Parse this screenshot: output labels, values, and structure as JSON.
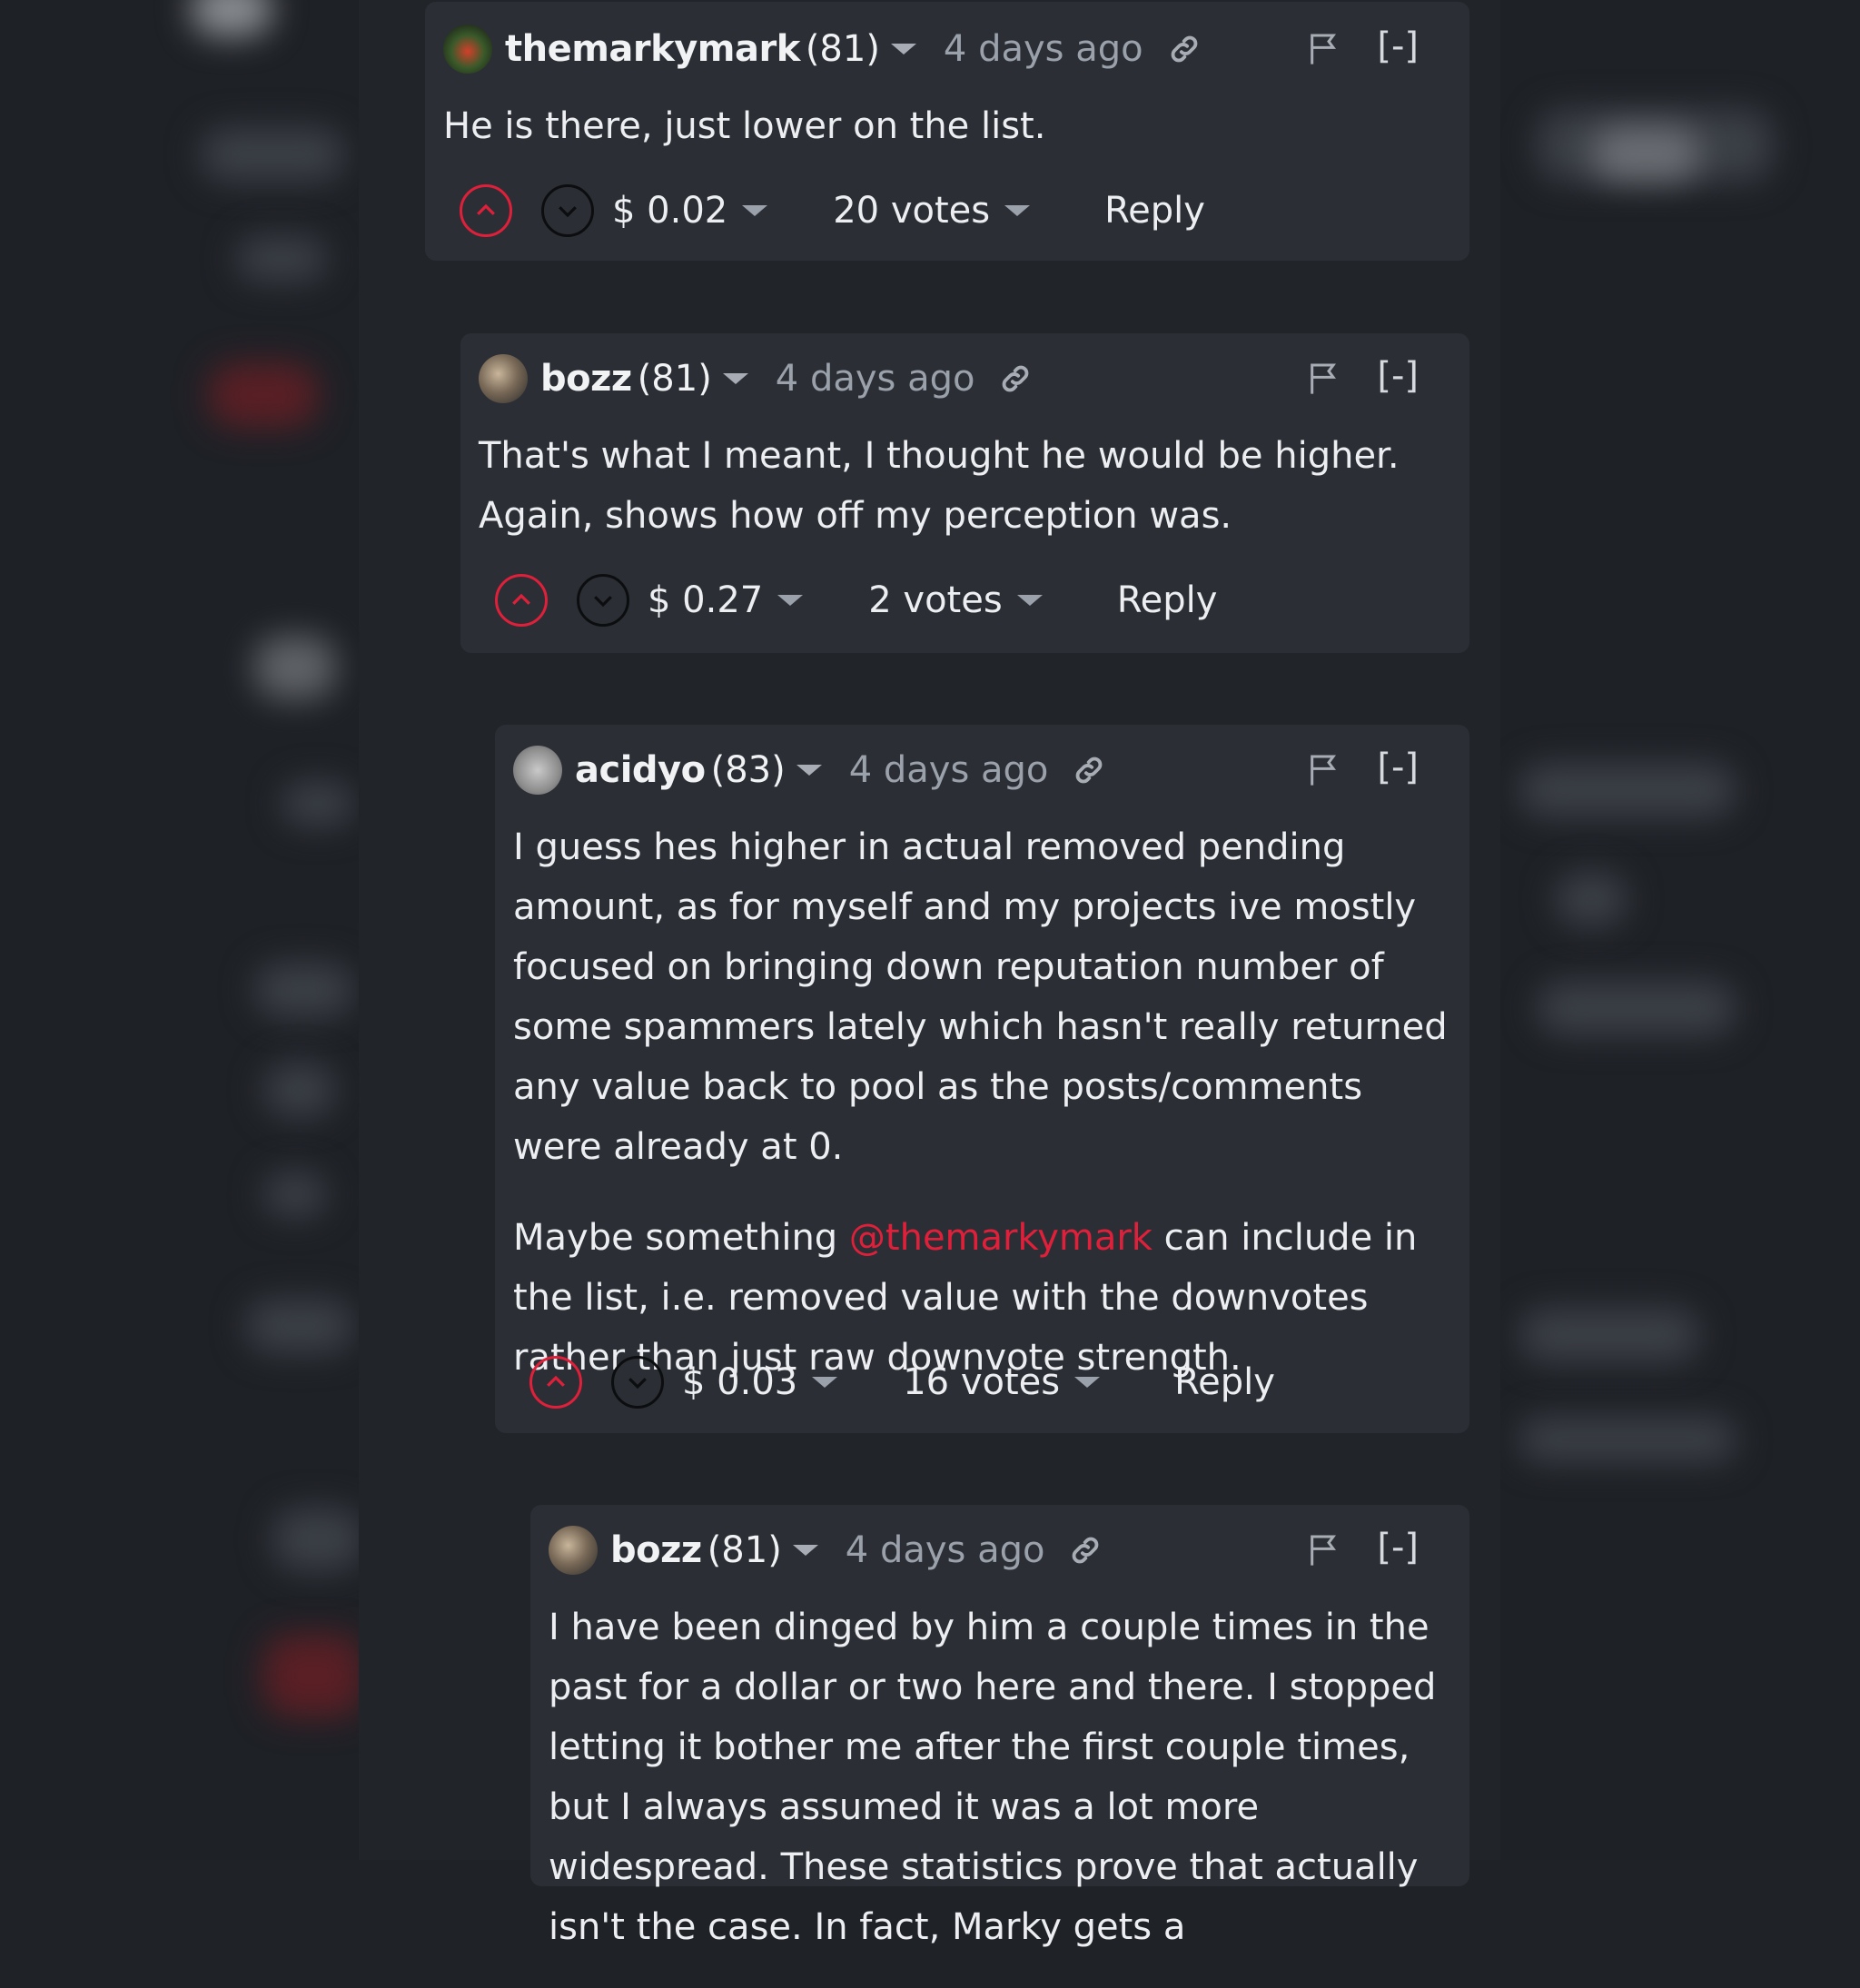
{
  "comments": [
    {
      "author": "themarkymark",
      "reputation": "(81)",
      "time": "4 days ago",
      "body": [
        "He is there, just lower on the list."
      ],
      "payout": "$ 0.02",
      "votes": "20 votes",
      "reply_label": "Reply",
      "collapse_label": "[-]"
    },
    {
      "author": "bozz",
      "reputation": "(81)",
      "time": "4 days ago",
      "body": [
        "That's what I meant, I thought he would be higher. Again, shows how off my perception was."
      ],
      "payout": "$ 0.27",
      "votes": "2 votes",
      "reply_label": "Reply",
      "collapse_label": "[-]"
    },
    {
      "author": "acidyo",
      "reputation": "(83)",
      "time": "4 days ago",
      "body": [
        "I guess hes higher in actual removed pending amount, as for myself and my projects ive mostly focused on bringing down reputation number of some spammers lately which hasn't really returned any value back to pool as the posts/comments were already at 0."
      ],
      "body2_before": "Maybe something ",
      "mention": "@themarkymark",
      "body2_after": " can include in the list, i.e. removed value with the downvotes rather than just raw downvote strength.",
      "payout": "$ 0.03",
      "votes": "16 votes",
      "reply_label": "Reply",
      "collapse_label": "[-]"
    },
    {
      "author": "bozz",
      "reputation": "(81)",
      "time": "4 days ago",
      "body": [
        "I have been dinged by him a couple times in the past for a dollar or two here and there. I stopped letting it bother me after the first couple times, but I always assumed it was a lot more widespread. These statistics prove that actually isn't the case. In fact, Marky gets a"
      ],
      "collapse_label": "[-]"
    }
  ],
  "colors": {
    "accent": "#e0203a",
    "card": "#2b2f35",
    "background": "#1f2227"
  },
  "icons": [
    "link-icon",
    "flag-icon",
    "upvote-icon",
    "downvote-icon"
  ]
}
